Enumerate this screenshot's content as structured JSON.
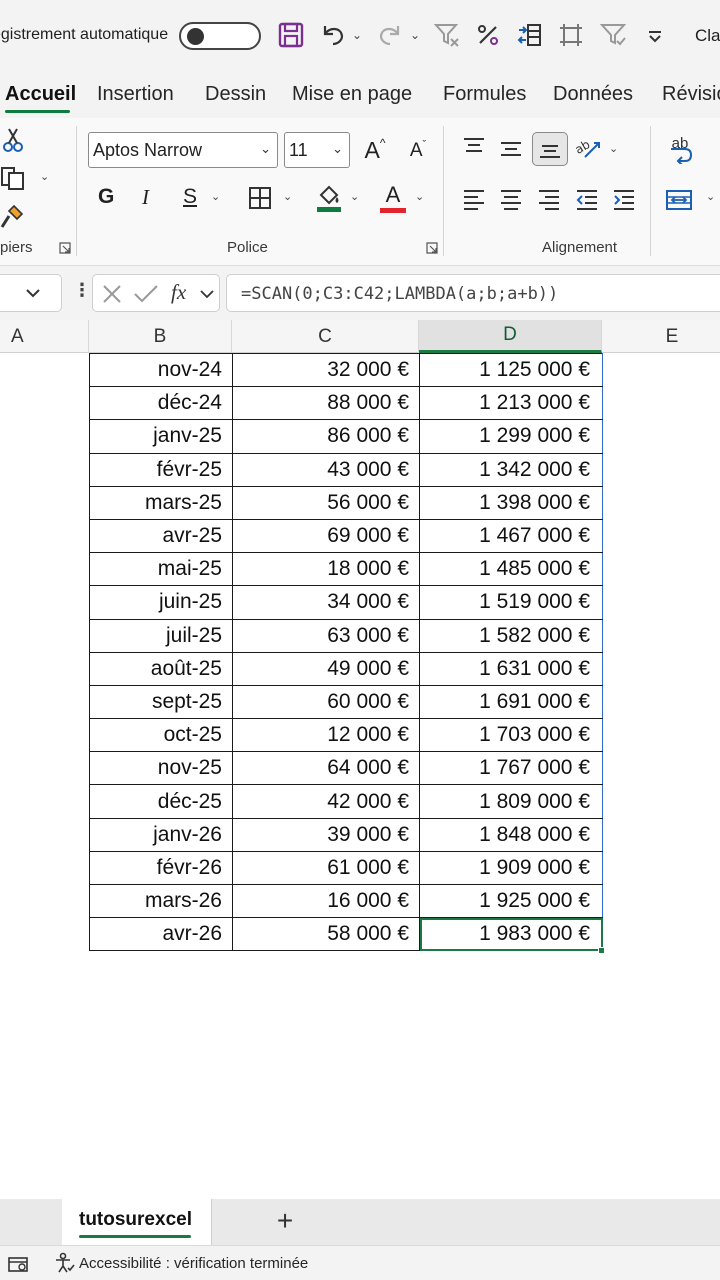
{
  "titlebar": {
    "autosave_label": "egistrement automatique",
    "user_truncated": "Cla",
    "icons": [
      "save-icon",
      "undo-icon",
      "redo-icon",
      "clear-filter-icon",
      "percent-icon",
      "data-tool-icon",
      "select-icon",
      "filter-icon",
      "customize-icon"
    ]
  },
  "ribbon": {
    "tabs": [
      {
        "label": "Accueil",
        "active": true
      },
      {
        "label": "Insertion"
      },
      {
        "label": "Dessin"
      },
      {
        "label": "Mise en page"
      },
      {
        "label": "Formules"
      },
      {
        "label": "Données"
      },
      {
        "label": "Révisio"
      }
    ],
    "groups": {
      "clipboard_label": "piers",
      "font_label": "Police",
      "alignment_label": "Alignement"
    },
    "font": {
      "name": "Aptos Narrow",
      "size": "11",
      "bold": "G",
      "italic": "I",
      "underline": "S",
      "grow": "A",
      "shrink": "A",
      "color_letter": "A"
    },
    "wrap_text": "ab",
    "accent_green": "#0f7b3f",
    "font_color_red": "#e3242b"
  },
  "formula_bar": {
    "fx": "fx",
    "formula": "=SCAN(0;C3:C42;LAMBDA(a;b;a+b))"
  },
  "columns": [
    "A",
    "B",
    "C",
    "D",
    "E"
  ],
  "selected_column": "D",
  "rows": [
    {
      "month": "nov-24",
      "amount": "32 000 €",
      "cumulative": "1 125 000 €"
    },
    {
      "month": "déc-24",
      "amount": "88 000 €",
      "cumulative": "1 213 000 €"
    },
    {
      "month": "janv-25",
      "amount": "86 000 €",
      "cumulative": "1 299 000 €"
    },
    {
      "month": "févr-25",
      "amount": "43 000 €",
      "cumulative": "1 342 000 €"
    },
    {
      "month": "mars-25",
      "amount": "56 000 €",
      "cumulative": "1 398 000 €"
    },
    {
      "month": "avr-25",
      "amount": "69 000 €",
      "cumulative": "1 467 000 €"
    },
    {
      "month": "mai-25",
      "amount": "18 000 €",
      "cumulative": "1 485 000 €"
    },
    {
      "month": "juin-25",
      "amount": "34 000 €",
      "cumulative": "1 519 000 €"
    },
    {
      "month": "juil-25",
      "amount": "63 000 €",
      "cumulative": "1 582 000 €"
    },
    {
      "month": "août-25",
      "amount": "49 000 €",
      "cumulative": "1 631 000 €"
    },
    {
      "month": "sept-25",
      "amount": "60 000 €",
      "cumulative": "1 691 000 €"
    },
    {
      "month": "oct-25",
      "amount": "12 000 €",
      "cumulative": "1 703 000 €"
    },
    {
      "month": "nov-25",
      "amount": "64 000 €",
      "cumulative": "1 767 000 €"
    },
    {
      "month": "déc-25",
      "amount": "42 000 €",
      "cumulative": "1 809 000 €"
    },
    {
      "month": "janv-26",
      "amount": "39 000 €",
      "cumulative": "1 848 000 €"
    },
    {
      "month": "févr-26",
      "amount": "61 000 €",
      "cumulative": "1 909 000 €"
    },
    {
      "month": "mars-26",
      "amount": "16 000 €",
      "cumulative": "1 925 000 €"
    },
    {
      "month": "avr-26",
      "amount": "58 000 €",
      "cumulative": "1 983 000 €"
    }
  ],
  "sheet": {
    "name": "tutosurexcel",
    "add": "+"
  },
  "status": {
    "accessibility": "Accessibilité : vérification terminée"
  }
}
